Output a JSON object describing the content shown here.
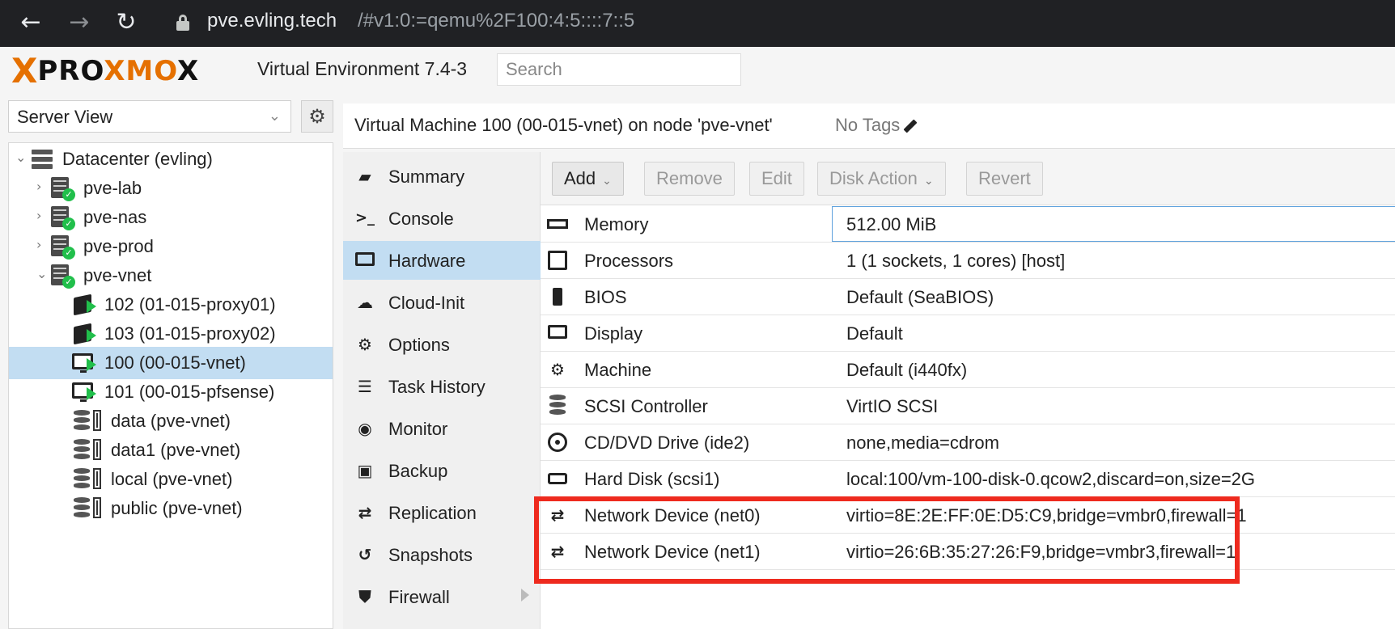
{
  "browser": {
    "url_host": "pve.evling.tech",
    "url_path": "/#v1:0:=qemu%2F100:4:5::::7::5"
  },
  "header": {
    "logo_left": "X",
    "logo_text_a": "PRO",
    "logo_text_b": "XMO",
    "logo_text_c": "X",
    "title": "Virtual Environment 7.4-3",
    "search_placeholder": "Search"
  },
  "left_panel": {
    "view_label": "Server View",
    "tree": [
      {
        "label": "Datacenter (evling)",
        "type": "datacenter",
        "expanded": true
      },
      {
        "label": "pve-lab",
        "type": "node",
        "status": "online"
      },
      {
        "label": "pve-nas",
        "type": "node",
        "status": "online"
      },
      {
        "label": "pve-prod",
        "type": "node",
        "status": "online"
      },
      {
        "label": "pve-vnet",
        "type": "node",
        "status": "online",
        "expanded": true
      },
      {
        "label": "102 (01-015-proxy01)",
        "type": "container",
        "status": "running"
      },
      {
        "label": "103 (01-015-proxy02)",
        "type": "container",
        "status": "running"
      },
      {
        "label": "100 (00-015-vnet)",
        "type": "vm",
        "status": "running",
        "selected": true
      },
      {
        "label": "101 (00-015-pfsense)",
        "type": "vm",
        "status": "running"
      },
      {
        "label": "data (pve-vnet)",
        "type": "storage"
      },
      {
        "label": "data1 (pve-vnet)",
        "type": "storage"
      },
      {
        "label": "local (pve-vnet)",
        "type": "storage"
      },
      {
        "label": "public (pve-vnet)",
        "type": "storage"
      }
    ]
  },
  "main": {
    "title": "Virtual Machine 100 (00-015-vnet) on node 'pve-vnet'",
    "tags_label": "No Tags",
    "nav": [
      {
        "label": "Summary",
        "icon": "book-icon"
      },
      {
        "label": "Console",
        "icon": "terminal-icon"
      },
      {
        "label": "Hardware",
        "icon": "monitor-icon",
        "active": true
      },
      {
        "label": "Cloud-Init",
        "icon": "cloud-icon"
      },
      {
        "label": "Options",
        "icon": "gear-icon"
      },
      {
        "label": "Task History",
        "icon": "list-icon"
      },
      {
        "label": "Monitor",
        "icon": "eye-icon"
      },
      {
        "label": "Backup",
        "icon": "floppy-icon"
      },
      {
        "label": "Replication",
        "icon": "retweet-icon"
      },
      {
        "label": "Snapshots",
        "icon": "history-icon"
      },
      {
        "label": "Firewall",
        "icon": "shield-icon",
        "has_submenu": true
      }
    ],
    "toolbar": {
      "add": "Add",
      "remove": "Remove",
      "edit": "Edit",
      "disk_action": "Disk Action",
      "revert": "Revert"
    },
    "hardware": [
      {
        "name": "Memory",
        "value": "512.00 MiB",
        "icon": "memory-icon"
      },
      {
        "name": "Processors",
        "value": "1 (1 sockets, 1 cores) [host]",
        "icon": "cpu-icon"
      },
      {
        "name": "BIOS",
        "value": "Default (SeaBIOS)",
        "icon": "microchip-icon"
      },
      {
        "name": "Display",
        "value": "Default",
        "icon": "desktop-icon"
      },
      {
        "name": "Machine",
        "value": "Default (i440fx)",
        "icon": "cogs-icon"
      },
      {
        "name": "SCSI Controller",
        "value": "VirtIO SCSI",
        "icon": "database-icon"
      },
      {
        "name": "CD/DVD Drive (ide2)",
        "value": "none,media=cdrom",
        "icon": "cdrom-icon"
      },
      {
        "name": "Hard Disk (scsi1)",
        "value": "local:100/vm-100-disk-0.qcow2,discard=on,size=2G",
        "icon": "hdd-icon"
      },
      {
        "name": "Network Device (net0)",
        "value": "virtio=8E:2E:FF:0E:D5:C9,bridge=vmbr0,firewall=1",
        "icon": "exchange-icon"
      },
      {
        "name": "Network Device (net1)",
        "value": "virtio=26:6B:35:27:26:F9,bridge=vmbr3,firewall=1",
        "icon": "exchange-icon"
      }
    ]
  },
  "colors": {
    "accent": "#e57000",
    "selection": "#c2ddf2",
    "status_ok": "#21bf4b",
    "annotation_red": "#ee2a1e",
    "browser_bar": "#202124"
  }
}
